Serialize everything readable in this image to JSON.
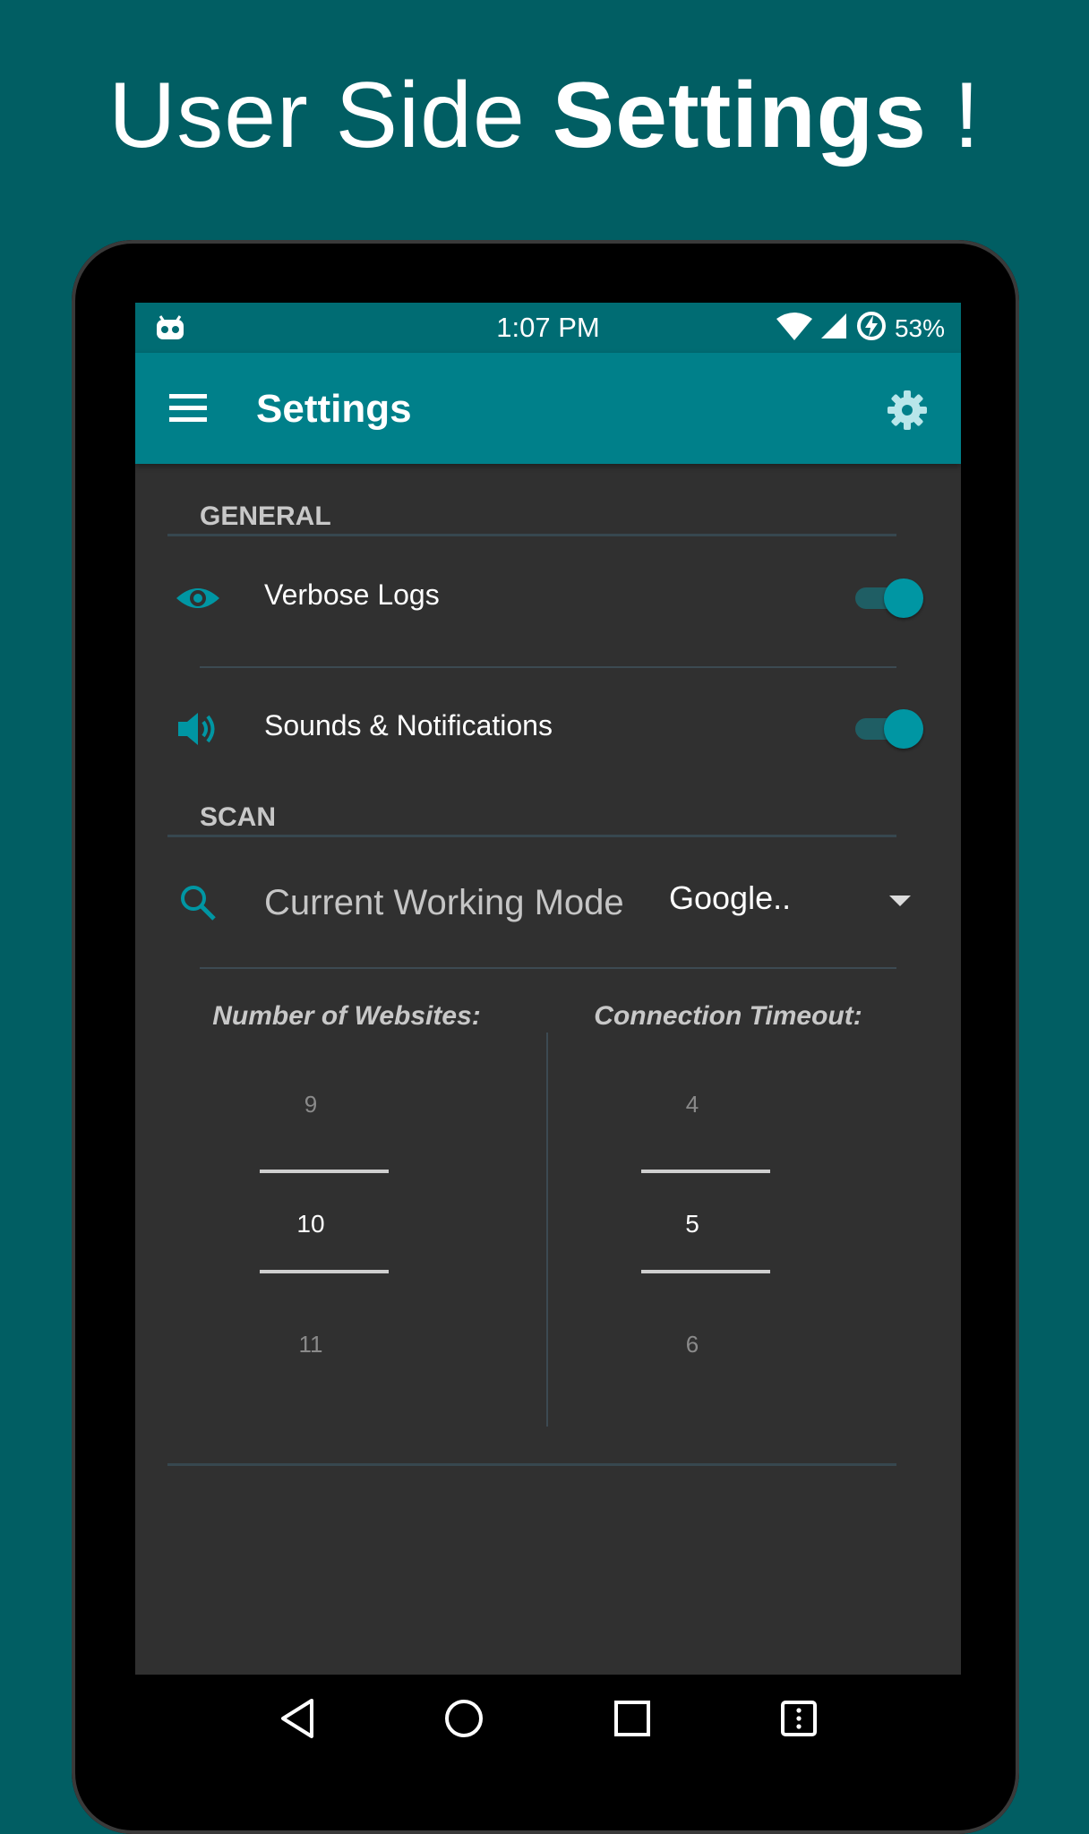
{
  "headline": {
    "light": "User Side ",
    "bold": "Settings",
    "suffix": " !"
  },
  "status_bar": {
    "time": "1:07 PM",
    "battery": "53%"
  },
  "app_bar": {
    "title": "Settings",
    "menu_icon": "hamburger-menu-icon",
    "settings_icon": "gear-icon"
  },
  "general": {
    "header": "GENERAL",
    "verbose_logs": {
      "label": "Verbose Logs",
      "icon": "eye-icon",
      "enabled": true
    },
    "sounds": {
      "label": "Sounds & Notifications",
      "icon": "volume-icon",
      "enabled": true
    }
  },
  "scan": {
    "header": "SCAN",
    "working_mode": {
      "label": "Current Working Mode",
      "value": "Google..",
      "icon": "search-icon"
    },
    "websites": {
      "title": "Number of Websites:",
      "prev": "9",
      "selected": "10",
      "next": "11"
    },
    "timeout": {
      "title": "Connection Timeout:",
      "prev": "4",
      "selected": "5",
      "next": "6"
    }
  },
  "nav_bar": {
    "icons": [
      "back-icon",
      "home-icon",
      "recents-icon",
      "menu-icon"
    ]
  },
  "colors": {
    "accent": "#0096a3",
    "app_bar": "#00808a",
    "status_bar": "#006c73",
    "background": "#015e63",
    "surface": "#303030"
  }
}
